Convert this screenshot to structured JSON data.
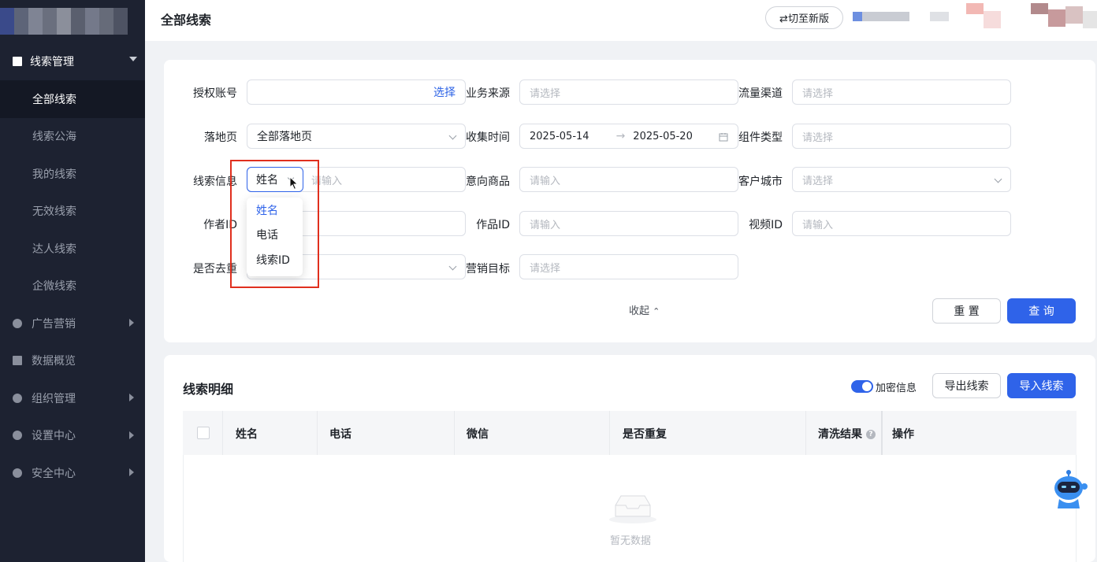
{
  "header": {
    "title": "全部线索",
    "switch_label": "⇄切至新版"
  },
  "sidebar": {
    "group_label": "线索管理",
    "sub_items": [
      {
        "label": "全部线索"
      },
      {
        "label": "线索公海"
      },
      {
        "label": "我的线索"
      },
      {
        "label": "无效线索"
      },
      {
        "label": "达人线索"
      },
      {
        "label": "企微线索"
      }
    ],
    "items": [
      {
        "label": "广告营销",
        "icon": "target-icon"
      },
      {
        "label": "数据概览",
        "icon": "chart-icon"
      },
      {
        "label": "组织管理",
        "icon": "cube-icon"
      },
      {
        "label": "设置中心",
        "icon": "gear-icon"
      },
      {
        "label": "安全中心",
        "icon": "shield-icon"
      }
    ]
  },
  "filters": {
    "auth_account": {
      "label": "授权账号",
      "link": "选择"
    },
    "biz_source": {
      "label": "业务来源",
      "placeholder": "请选择"
    },
    "traffic_channel": {
      "label": "流量渠道",
      "placeholder": "请选择"
    },
    "landing_page": {
      "label": "落地页",
      "value": "全部落地页"
    },
    "collect_time": {
      "label": "收集时间",
      "start": "2025-05-14",
      "end": "2025-05-20",
      "sep": "→"
    },
    "component_type": {
      "label": "组件类型",
      "placeholder": "请选择"
    },
    "lead_info": {
      "label": "线索信息",
      "select_value": "姓名",
      "placeholder": "请输入"
    },
    "intent_product": {
      "label": "意向商品",
      "placeholder": "请输入"
    },
    "customer_city": {
      "label": "客户城市",
      "placeholder": "请选择"
    },
    "author_id": {
      "label": "作者ID"
    },
    "work_id": {
      "label": "作品ID",
      "placeholder": "请输入"
    },
    "video_id": {
      "label": "视频ID",
      "placeholder": "请输入"
    },
    "dedup": {
      "label": "是否去重"
    },
    "marketing_goal": {
      "label": "营销目标",
      "placeholder": "请选择"
    },
    "collapse_label": "收起",
    "reset_label": "重 置",
    "query_label": "查 询"
  },
  "dropdown": {
    "options": [
      "姓名",
      "电话",
      "线索ID"
    ],
    "selected": "姓名"
  },
  "detail": {
    "title": "线索明细",
    "toggle_label": "加密信息",
    "export_label": "导出线索",
    "import_label": "导入线索",
    "columns": [
      "姓名",
      "电话",
      "微信",
      "是否重复",
      "清洗结果",
      "操作"
    ],
    "empty_text": "暂无数据"
  },
  "colors": {
    "primary": "#2f63e9",
    "sidebar_bg": "#1d2231",
    "highlight_box": "#e02f1e"
  }
}
